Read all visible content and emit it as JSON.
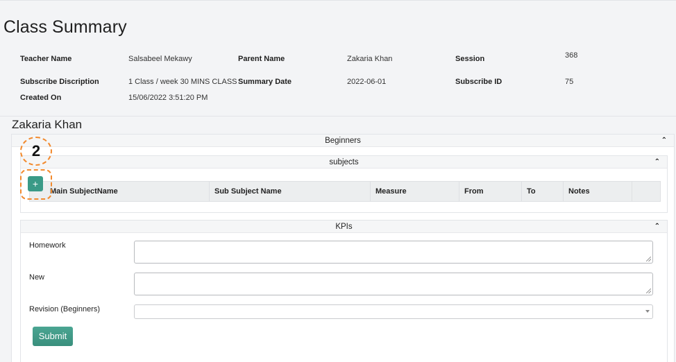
{
  "page": {
    "title": "Class Summary",
    "student_name": "Zakaria Khan"
  },
  "info": {
    "teacher_name_label": "Teacher Name",
    "teacher_name_value": "Salsabeel Mekawy",
    "parent_name_label": "Parent Name",
    "parent_name_value": "Zakaria Khan",
    "session_label": "Session",
    "session_value": "368",
    "subscribe_description_label": "Subscribe Discription",
    "subscribe_description_value": "1 Class / week 30 MINS CLASS",
    "summary_date_label": "Summary Date",
    "summary_date_value": "2022-06-01",
    "subscribe_id_label": "Subscribe ID",
    "subscribe_id_value": "75",
    "created_on_label": "Created On",
    "created_on_value": "15/06/2022 3:51:20 PM"
  },
  "level_panel": {
    "title": "Beginners"
  },
  "subjects_panel": {
    "title": "subjects",
    "add_label": "+",
    "columns": [
      "Main SubjectName",
      "Sub Subject Name",
      "Measure",
      "From",
      "To",
      "Notes",
      ""
    ]
  },
  "kpis_panel": {
    "title": "KPIs",
    "homework_label": "Homework",
    "new_label": "New",
    "revision_label": "Revision (Beginners)",
    "submit_label": "Submit"
  },
  "annotation": {
    "step_number": "2",
    "color": "#f28a2e"
  },
  "icons": {
    "collapse": "chevron-up-icon"
  }
}
